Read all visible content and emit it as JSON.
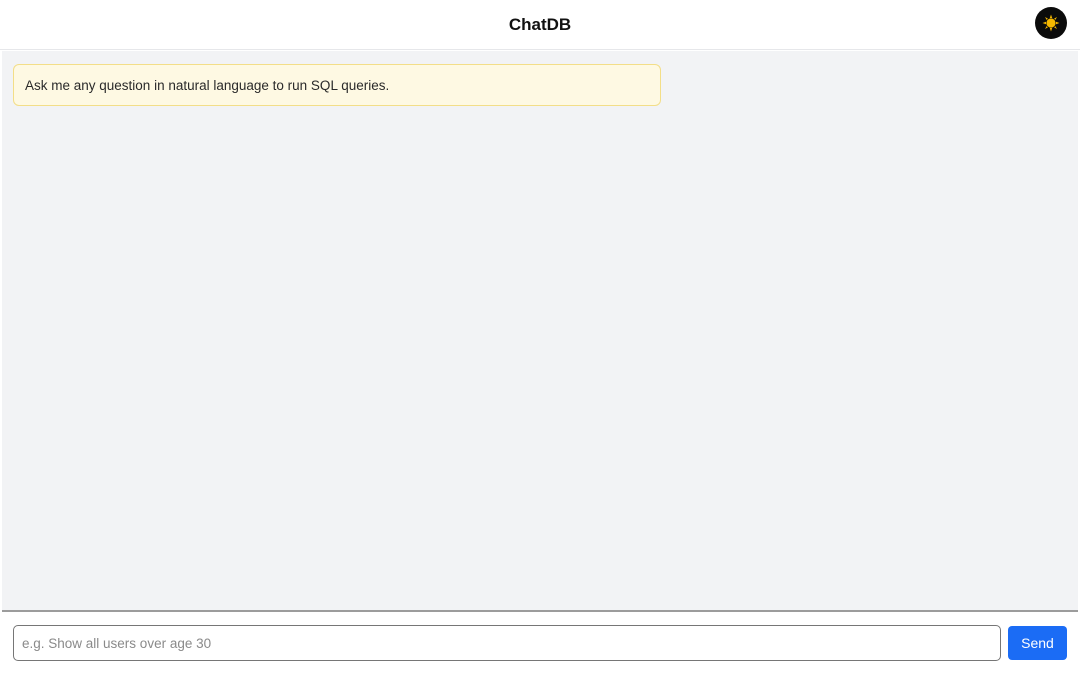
{
  "app": {
    "title": "ChatDB"
  },
  "header": {
    "theme_toggle_icon": "sun-icon",
    "theme_toggle_bg": "#0b0b0b",
    "sun_color": "#f5b800"
  },
  "chat": {
    "messages": [
      {
        "role": "system",
        "text": "Ask me any question in natural language to run SQL queries."
      }
    ]
  },
  "composer": {
    "placeholder": "e.g. Show all users over age 30",
    "value": "",
    "send_label": "Send",
    "send_color": "#1b6cf5"
  }
}
